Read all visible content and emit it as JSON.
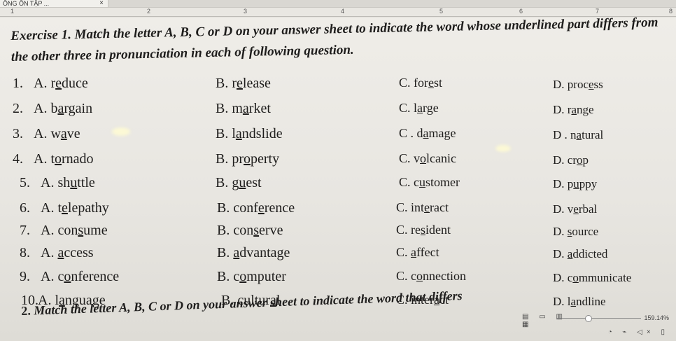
{
  "tab": {
    "title": "ÔNG ÔN TẬP ...",
    "close": "×"
  },
  "ruler": {
    "marks": [
      "1",
      "2",
      "3",
      "4",
      "5",
      "6",
      "7",
      "8"
    ]
  },
  "exercise": {
    "title": "Exercise 1. Match the letter A, B, C or D on your answer sheet to indicate the word whose underlined part differs from the other three in pronunciation in each of following question.",
    "questions": [
      {
        "num": "1.",
        "options": [
          {
            "label": "A.",
            "pre": "r",
            "u": "e",
            "post": "duce"
          },
          {
            "label": "B.",
            "pre": "r",
            "u": "e",
            "post": "lease"
          },
          {
            "label": "C.",
            "pre": "for",
            "u": "e",
            "post": "st"
          },
          {
            "label": "D.",
            "pre": "proc",
            "u": "e",
            "post": "ss"
          }
        ]
      },
      {
        "num": "2.",
        "options": [
          {
            "label": "A.",
            "pre": "b",
            "u": "a",
            "post": "rgain"
          },
          {
            "label": "B.",
            "pre": "m",
            "u": "a",
            "post": "rket"
          },
          {
            "label": "C.",
            "pre": "l",
            "u": "a",
            "post": "rge"
          },
          {
            "label": "D.",
            "pre": "r",
            "u": "a",
            "post": "nge"
          }
        ]
      },
      {
        "num": "3.",
        "options": [
          {
            "label": "A.",
            "pre": "w",
            "u": "a",
            "post": "ve"
          },
          {
            "label": "B.",
            "pre": "l",
            "u": "a",
            "post": "ndslide"
          },
          {
            "label": "C .",
            "pre": "d",
            "u": "a",
            "post": "mage"
          },
          {
            "label": "D .",
            "pre": "n",
            "u": "a",
            "post": "tural"
          }
        ]
      },
      {
        "num": "4.",
        "options": [
          {
            "label": "A.",
            "pre": "t",
            "u": "o",
            "post": "rnado"
          },
          {
            "label": "B.",
            "pre": "pr",
            "u": "o",
            "post": "perty"
          },
          {
            "label": "C.",
            "pre": "v",
            "u": "o",
            "post": "lcanic"
          },
          {
            "label": "D.",
            "pre": "cr",
            "u": "o",
            "post": "p"
          }
        ]
      },
      {
        "num": "5.",
        "options": [
          {
            "label": "A.",
            "pre": "sh",
            "u": "u",
            "post": "ttle"
          },
          {
            "label": "B.",
            "pre": "g",
            "u": "u",
            "post": "est"
          },
          {
            "label": "C.",
            "pre": "c",
            "u": "u",
            "post": "stomer"
          },
          {
            "label": "D.",
            "pre": "p",
            "u": "u",
            "post": "ppy"
          }
        ]
      },
      {
        "num": "6.",
        "options": [
          {
            "label": "A.",
            "pre": "t",
            "u": "e",
            "post": "lepathy"
          },
          {
            "label": "B.",
            "pre": "conf",
            "u": "e",
            "post": "rence"
          },
          {
            "label": "C.",
            "pre": "int",
            "u": "e",
            "post": "ract"
          },
          {
            "label": "D.",
            "pre": "v",
            "u": "e",
            "post": "rbal"
          }
        ]
      },
      {
        "num": "7.",
        "options": [
          {
            "label": "A.",
            "pre": "con",
            "u": "s",
            "post": "ume"
          },
          {
            "label": "B.",
            "pre": "con",
            "u": "s",
            "post": "erve"
          },
          {
            "label": "C.",
            "pre": "re",
            "u": "s",
            "post": "ident"
          },
          {
            "label": "D.",
            "pre": "",
            "u": "s",
            "post": "ource"
          }
        ]
      },
      {
        "num": "8.",
        "options": [
          {
            "label": "A.",
            "pre": "",
            "u": "a",
            "post": "ccess"
          },
          {
            "label": "B.",
            "pre": "",
            "u": "a",
            "post": "dvantage"
          },
          {
            "label": "C.",
            "pre": "",
            "u": "a",
            "post": "ffect"
          },
          {
            "label": "D.",
            "pre": "",
            "u": "a",
            "post": "ddicted"
          }
        ]
      },
      {
        "num": "9.",
        "options": [
          {
            "label": "A.",
            "pre": "c",
            "u": "o",
            "post": "nference"
          },
          {
            "label": "B.",
            "pre": "c",
            "u": "o",
            "post": "mputer"
          },
          {
            "label": "C.",
            "pre": "c",
            "u": "o",
            "post": "nnection"
          },
          {
            "label": "D.",
            "pre": "c",
            "u": "o",
            "post": "mmunicate"
          }
        ]
      },
      {
        "num": "10.",
        "options": [
          {
            "label": "A.",
            "pre": "l",
            "u": "a",
            "post": "nguage"
          },
          {
            "label": "B.",
            "pre": "cultur",
            "u": "a",
            "post": "l"
          },
          {
            "label": "C.",
            "pre": "inter",
            "u": "a",
            "post": "ct"
          },
          {
            "label": "D.",
            "pre": "l",
            "u": "a",
            "post": "ndline"
          }
        ]
      }
    ]
  },
  "footer": {
    "num": "2.",
    "text": "Match the letter A, B, C or D on your answer sheet to indicate the word that differs"
  },
  "statusbar": {
    "zoom": "159.14%",
    "icons": "▤ ▭ ▥ ▦",
    "tray": "◔ ⌁ ◁× ▯"
  }
}
